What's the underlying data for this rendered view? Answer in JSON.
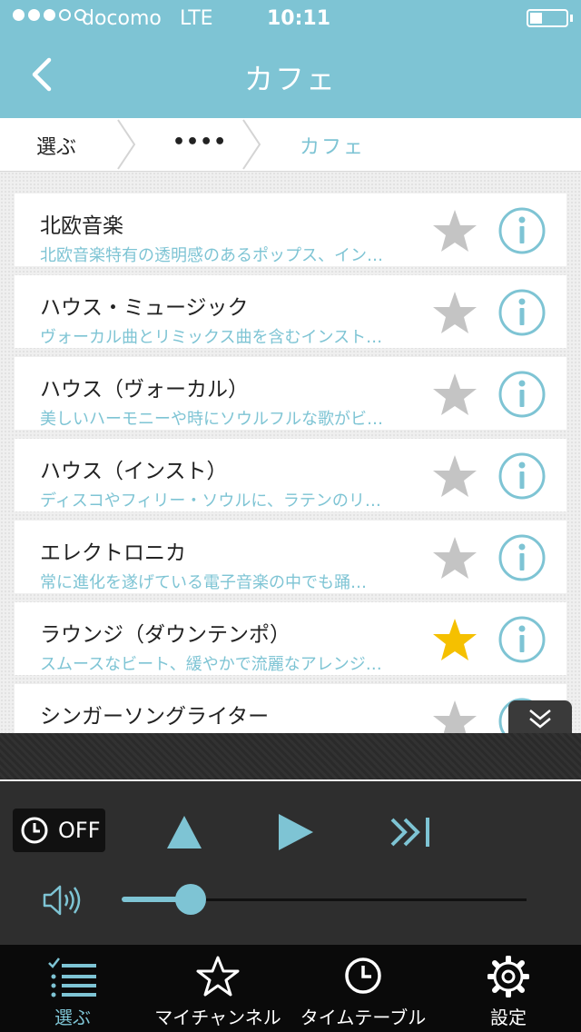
{
  "status_bar": {
    "carrier": "docomo",
    "network": "LTE",
    "time": "10:11",
    "signal_bars_filled": 3,
    "signal_bars_total": 5
  },
  "nav": {
    "title": "カフェ",
    "back_icon": "chevron-left-icon"
  },
  "breadcrumb": [
    "選ぶ",
    "••••",
    "カフェ"
  ],
  "rows": [
    {
      "title": "北欧音楽",
      "desc": "北欧音楽特有の透明感のあるポップス、イン…",
      "favorite": false
    },
    {
      "title": "ハウス・ミュージック",
      "desc": "ヴォーカル曲とリミックス曲を含むインスト…",
      "favorite": false
    },
    {
      "title": "ハウス（ヴォーカル）",
      "desc": "美しいハーモニーや時にソウルフルな歌がビ…",
      "favorite": false
    },
    {
      "title": "ハウス（インスト）",
      "desc": "ディスコやフィリー・ソウルに、ラテンのリ…",
      "favorite": false
    },
    {
      "title": "エレクトロニカ",
      "desc": "常に進化を遂げている電子音楽の中でも踊…",
      "favorite": false
    },
    {
      "title": "ラウンジ（ダウンテンポ）",
      "desc": "スムースなビート、緩やかで流麗なアレンジ…",
      "favorite": true
    },
    {
      "title": "シンガーソングライター",
      "desc": "",
      "favorite": false
    }
  ],
  "player": {
    "timer_label": "OFF",
    "volume": 0.17
  },
  "tabs": [
    {
      "label": "選ぶ",
      "icon": "list-icon",
      "active": true
    },
    {
      "label": "マイチャンネル",
      "icon": "star-icon",
      "active": false
    },
    {
      "label": "タイムテーブル",
      "icon": "clock-icon",
      "active": false
    },
    {
      "label": "設定",
      "icon": "gear-icon",
      "active": false
    }
  ],
  "colors": {
    "accent": "#7ec4d4",
    "star_on": "#f5c000",
    "star_off": "#c4c4c4",
    "player_bg": "#2e2e2e",
    "tabbar_bg": "#0a0a0a"
  }
}
